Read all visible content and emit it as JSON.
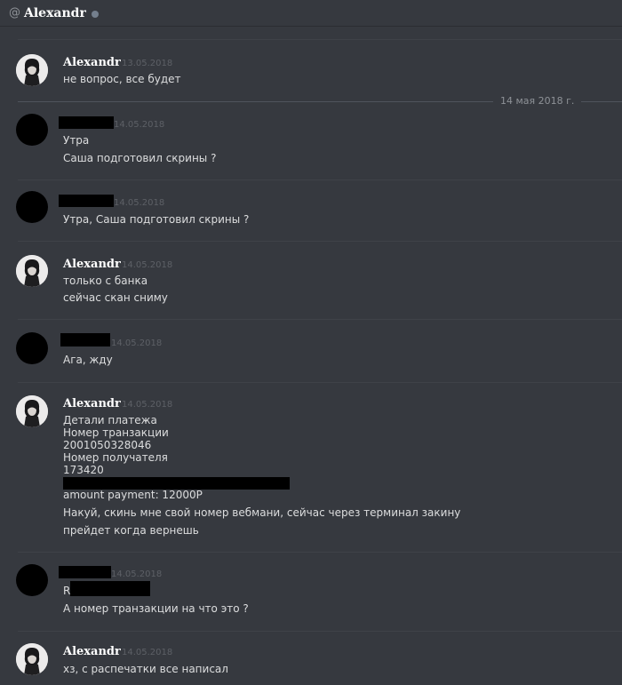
{
  "header": {
    "at": "@",
    "name": "Alexandr"
  },
  "date_divider": "14 мая 2018 г.",
  "messages": [
    {
      "author": "Alexandr",
      "time": "13.05.2018",
      "lines": [
        "не вопрос, все будет"
      ]
    },
    {
      "author": "",
      "time": "14.05.2018",
      "lines": [
        "Утра",
        "Саша подготовил скрины ?"
      ]
    },
    {
      "author": "",
      "time": "14.05.2018",
      "lines": [
        "Утра, Саша подготовил скрины ?"
      ]
    },
    {
      "author": "Alexandr",
      "time": "14.05.2018",
      "lines": [
        "только с банка",
        "сейчас скан сниму"
      ]
    },
    {
      "author": "",
      "time": "14.05.2018",
      "lines": [
        "Ага, жду"
      ]
    },
    {
      "author": "Alexandr",
      "time": "14.05.2018",
      "lines": [
        "Детали платежа",
        "Номер транзакции",
        "2001050328046",
        "Номер получателя",
        "173420",
        "",
        "amount payment: 12000Р",
        "Накуй, скинь мне свой номер вебмани, сейчас через терминал закину",
        "прейдет когда вернешь"
      ]
    },
    {
      "author": "",
      "time": "14.05.2018",
      "lines": [
        "R",
        "А номер транзакции на что это ?"
      ]
    },
    {
      "author": "Alexandr",
      "time": "14.05.2018",
      "lines": [
        "хз, с распечатки все написал"
      ]
    }
  ]
}
